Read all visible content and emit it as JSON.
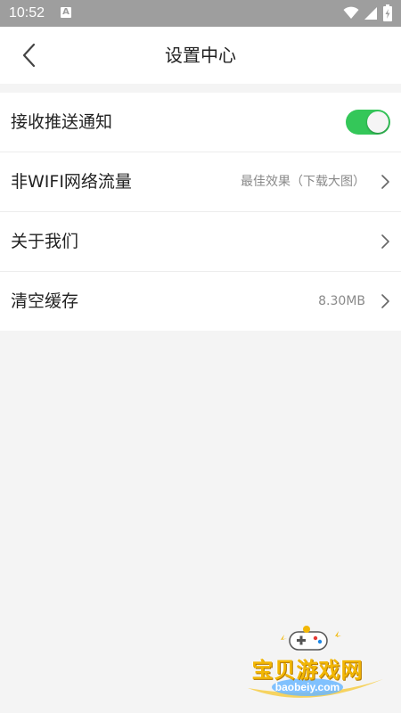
{
  "status_bar": {
    "time": "10:52",
    "notification_glyph": "A"
  },
  "header": {
    "title": "设置中心"
  },
  "settings": {
    "items": [
      {
        "label": "接收推送通知",
        "toggle_on": true
      },
      {
        "label": "非WIFI网络流量",
        "value": "最佳效果（下载大图）"
      },
      {
        "label": "关于我们"
      },
      {
        "label": "清空缓存",
        "value": "8.30MB"
      }
    ]
  },
  "watermark": {
    "title": "宝贝游戏网",
    "url": "baobeiy.com"
  },
  "colors": {
    "status_bar_bg": "#9e9e9e",
    "toggle_on": "#34c759",
    "page_bg": "#f4f4f4",
    "watermark_yellow": "#f2b705"
  }
}
